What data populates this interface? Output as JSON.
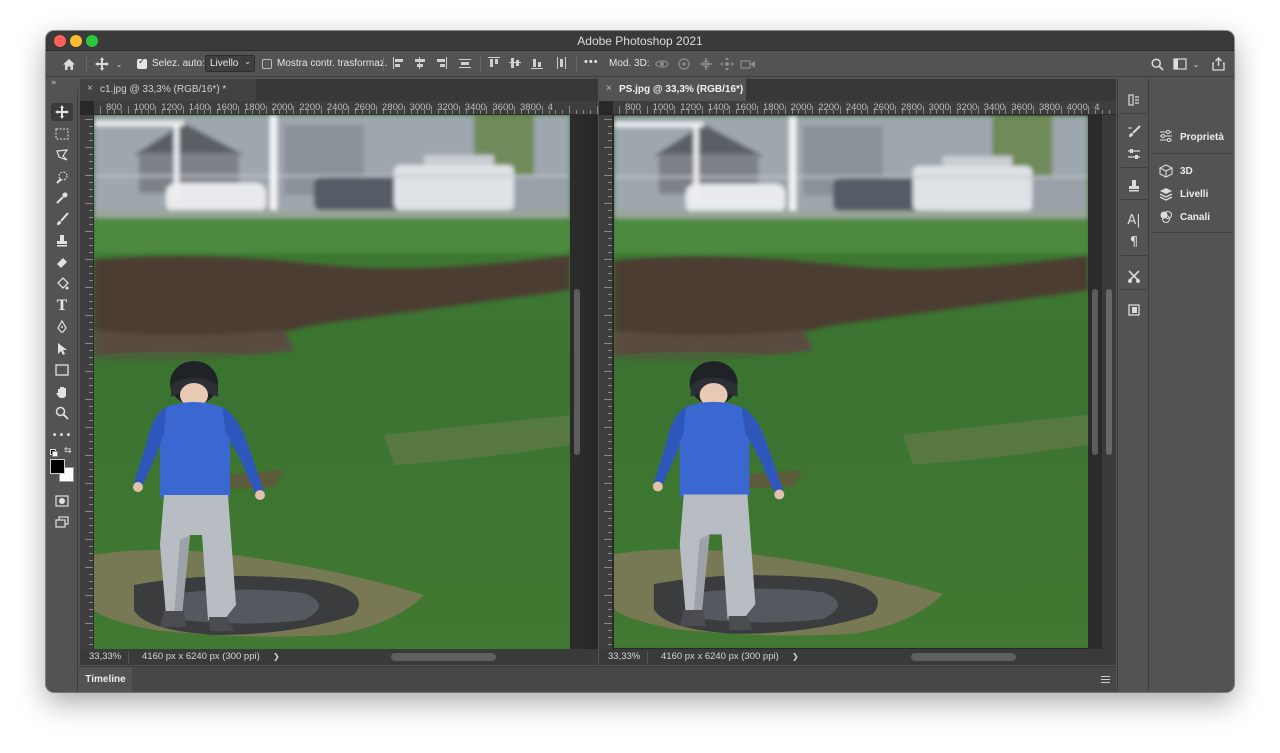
{
  "window": {
    "title": "Adobe Photoshop 2021"
  },
  "options_bar": {
    "auto_select_label": "Selez. auto:",
    "auto_select_checked": true,
    "auto_select_target": "Livello",
    "show_transform_label": "Mostra contr. trasformaz.",
    "show_transform_checked": false,
    "more_label": "•••",
    "mode_3d_label": "Mod. 3D:"
  },
  "documents": [
    {
      "tab_label": "c1.jpg @ 33,3% (RGB/16*) *",
      "active": false,
      "zoom": "33,33%",
      "doc_info": "4160 px x 6240 px (300 ppi)",
      "ruler_ticks": [
        "800",
        "1000",
        "1200",
        "1400",
        "1600",
        "1800",
        "2000",
        "2200",
        "2400",
        "2600",
        "2800",
        "3000",
        "3200",
        "3400",
        "3600",
        "3800",
        "4"
      ]
    },
    {
      "tab_label": "PS.jpg @ 33,3% (RGB/16*)",
      "active": true,
      "zoom": "33,33%",
      "doc_info": "4160 px x 6240 px (300 ppi)",
      "ruler_ticks": [
        "800",
        "1000",
        "1200",
        "1400",
        "1600",
        "1800",
        "2000",
        "2200",
        "2400",
        "2600",
        "2800",
        "3000",
        "3200",
        "3400",
        "3600",
        "3800",
        "4000",
        "4"
      ]
    }
  ],
  "status_arrow": "❯",
  "timeline": {
    "label": "Timeline"
  },
  "panels": {
    "properties": "Proprietà",
    "threed": "3D",
    "layers": "Livelli",
    "channels": "Canali"
  },
  "colors": {
    "foreground": "#000000",
    "background": "#ffffff",
    "ui_dark": "#535353",
    "shirt_blue": "#3a67d0",
    "grass_green": "#3f7d35"
  }
}
